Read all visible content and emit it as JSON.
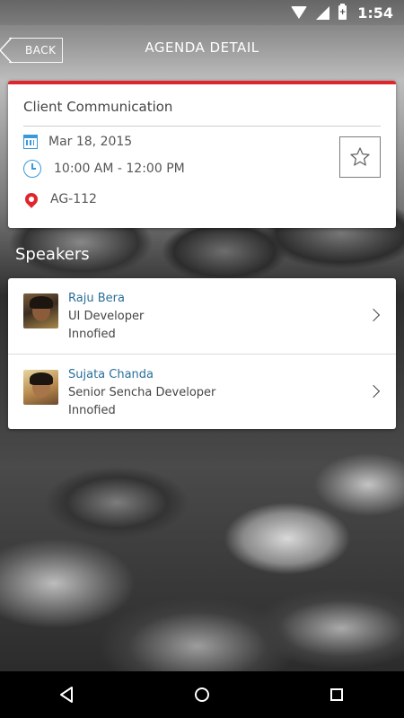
{
  "status_bar": {
    "time": "1:54",
    "battery_label": "+"
  },
  "header": {
    "back_label": "BACK",
    "title": "AGENDA DETAIL"
  },
  "agenda": {
    "title": "Client Communication",
    "date": "Mar 18, 2015",
    "time": "10:00 AM - 12:00 PM",
    "room": "AG-112",
    "favorite_icon": "star-icon"
  },
  "speakers": {
    "heading": "Speakers",
    "items": [
      {
        "name": "Raju Bera",
        "role": "UI Developer",
        "org": "Innofied"
      },
      {
        "name": "Sujata Chanda",
        "role": "Senior Sencha Developer",
        "org": "Innofied"
      }
    ]
  },
  "colors": {
    "accent_red": "#e0262d",
    "accent_blue": "#3a9ad9",
    "name_blue": "#2a6f99"
  },
  "nav": {
    "back_icon": "triangle-back-icon",
    "home_icon": "circle-home-icon",
    "recent_icon": "square-recent-icon"
  }
}
